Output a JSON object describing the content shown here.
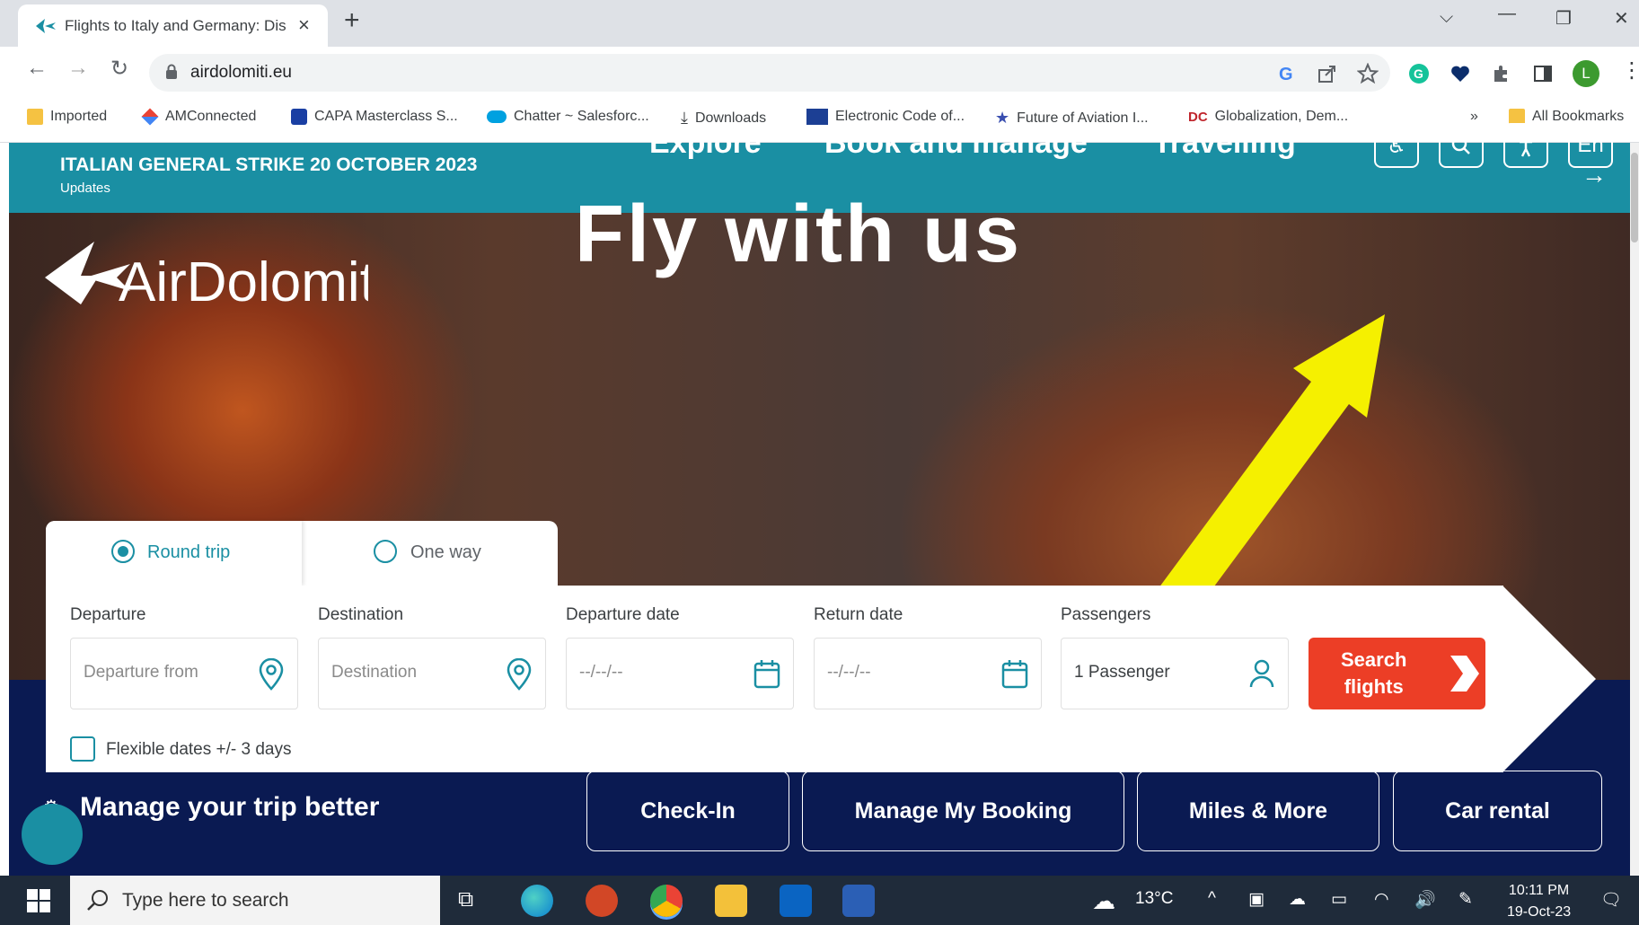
{
  "browser": {
    "tab_title": "Flights to Italy and Germany: Dis",
    "new_tab": "+",
    "url": "airdolomiti.eu",
    "bookmarks": [
      {
        "label": "Imported",
        "icon": "folder-icon"
      },
      {
        "label": "AMConnected",
        "icon": "diamond-icon"
      },
      {
        "label": "CAPA Masterclass S...",
        "icon": "capa-icon"
      },
      {
        "label": "Chatter ~ Salesforc...",
        "icon": "cloud-icon"
      },
      {
        "label": "Downloads",
        "icon": "download-icon"
      },
      {
        "label": "Electronic Code of...",
        "icon": "gpo-icon"
      },
      {
        "label": "Future of Aviation I...",
        "icon": "star-icon"
      },
      {
        "label": "Globalization, Dem...",
        "icon": "dc-icon"
      }
    ],
    "more": "»",
    "all_bookmarks": "All Bookmarks",
    "profile_initial": "L"
  },
  "banner": {
    "headline": "ITALIAN GENERAL STRIKE 20 OCTOBER 2023",
    "sub": "Updates"
  },
  "nav": {
    "items": [
      "Explore",
      "Book and manage",
      "Travelling"
    ],
    "language": "En"
  },
  "hero": {
    "title": "Fly with us",
    "logo_text": "AirDolomiti"
  },
  "booking": {
    "trip_types": [
      "Round trip",
      "One way"
    ],
    "selected_trip": "Round trip",
    "fields": [
      {
        "label": "Departure",
        "placeholder": "Departure from",
        "icon": "location-pin-icon"
      },
      {
        "label": "Destination",
        "placeholder": "Destination",
        "icon": "location-pin-icon"
      },
      {
        "label": "Departure date",
        "placeholder": "--/--/--",
        "icon": "calendar-icon"
      },
      {
        "label": "Return date",
        "placeholder": "--/--/--",
        "icon": "calendar-icon"
      }
    ],
    "passengers": {
      "label": "Passengers",
      "value": "1 Passenger",
      "icon": "person-icon"
    },
    "search_button": [
      "Search",
      "flights"
    ],
    "flexible": "Flexible dates +/- 3 days"
  },
  "manage": {
    "title": "Manage your trip better",
    "buttons": [
      "Check-In",
      "Manage My Booking",
      "Miles & More",
      "Car rental"
    ]
  },
  "taskbar": {
    "search_placeholder": "Type here to search",
    "weather": "13°C",
    "time": "10:11 PM",
    "date": "19-Oct-23"
  },
  "colors": {
    "teal": "#1a8fa3",
    "navy": "#0a1a52",
    "search_red": "#ec3e26",
    "highlight_arrow": "#f5f000"
  }
}
